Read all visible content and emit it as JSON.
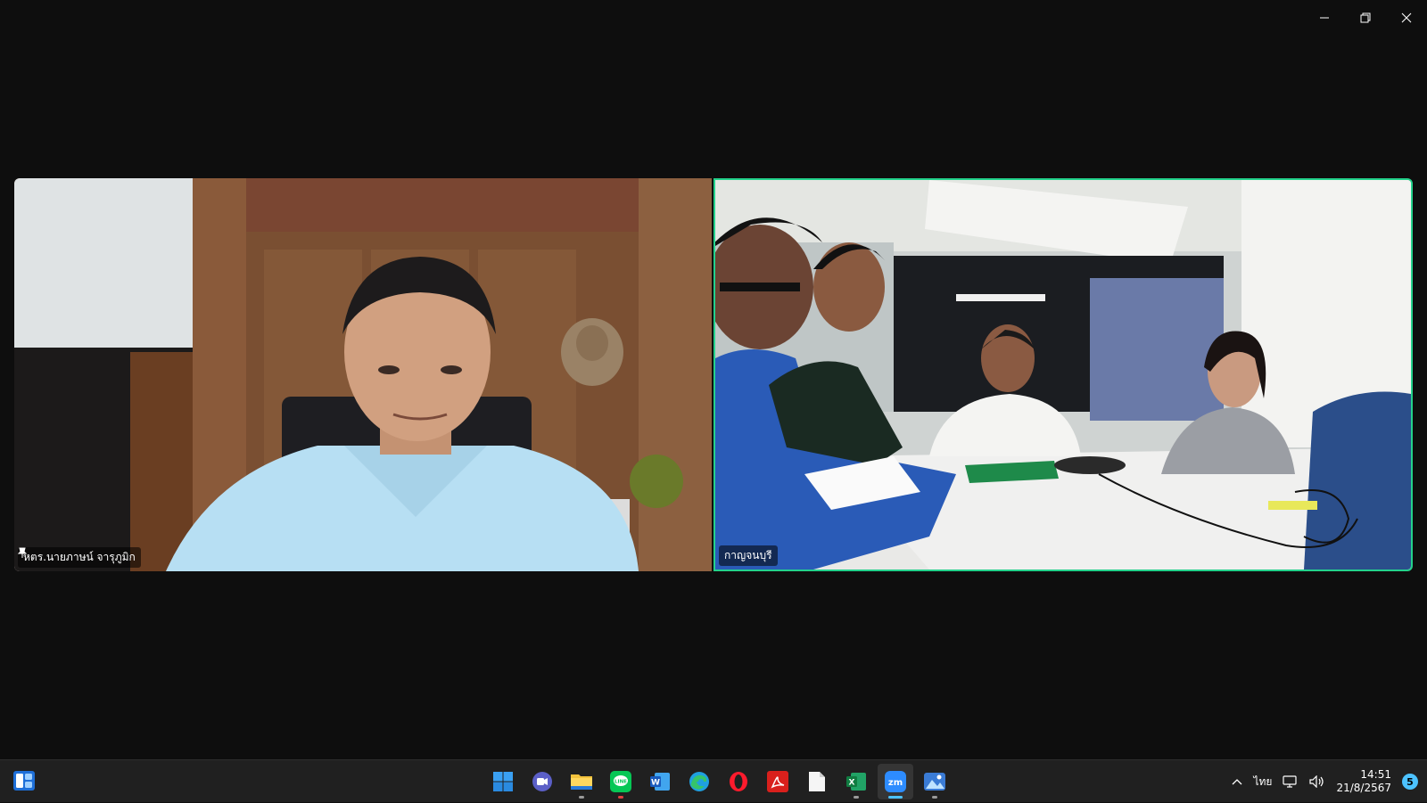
{
  "window": {
    "controls": [
      "minimize-icon",
      "restore-icon",
      "close-icon"
    ]
  },
  "participants": [
    {
      "name": "หตร.นายภาษน์ จารุภูมิก",
      "pinned": true
    },
    {
      "name": "กาญจนบุรี",
      "pinned": false,
      "active_speaker": true
    }
  ],
  "colors": {
    "active_speaker_border": "#23d18b",
    "taskbar": "#202020",
    "accent": "#4cc2ff"
  },
  "taskbar": {
    "apps": [
      {
        "name": "start",
        "icon": "windows-start-icon"
      },
      {
        "name": "teams",
        "icon": "meet-icon"
      },
      {
        "name": "file-explorer",
        "icon": "folder-icon",
        "running": true
      },
      {
        "name": "line",
        "icon": "line-app-icon",
        "running": true
      },
      {
        "name": "word",
        "icon": "word-icon"
      },
      {
        "name": "edge",
        "icon": "edge-icon"
      },
      {
        "name": "opera",
        "icon": "opera-icon"
      },
      {
        "name": "acrobat",
        "icon": "pdf-icon"
      },
      {
        "name": "notepad",
        "icon": "document-icon"
      },
      {
        "name": "excel",
        "icon": "excel-icon",
        "running": true
      },
      {
        "name": "zoom",
        "icon": "zoom-icon",
        "running": true,
        "active": true
      },
      {
        "name": "photos",
        "icon": "photos-icon",
        "running": true
      }
    ],
    "tray": {
      "language": "ไทย",
      "time": "14:51",
      "date": "21/8/2567",
      "notification_count": "5"
    }
  }
}
